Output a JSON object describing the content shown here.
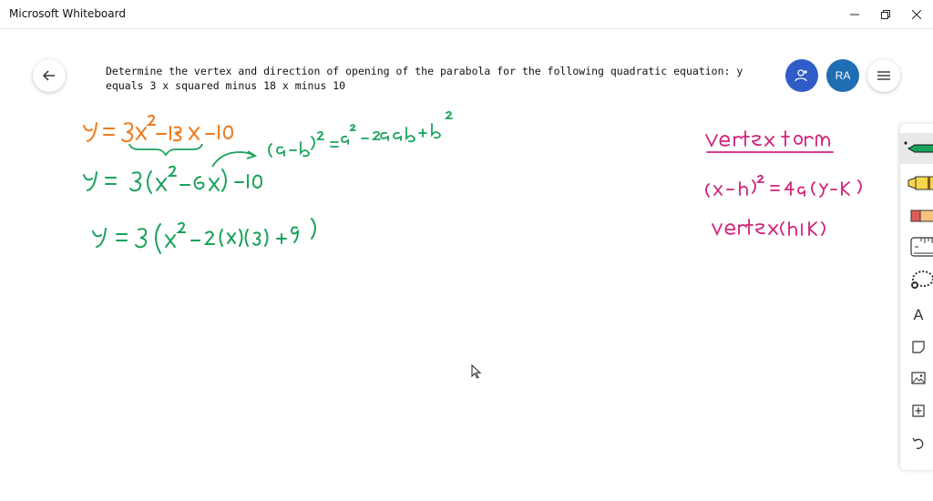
{
  "app": {
    "title": "Microsoft Whiteboard"
  },
  "window": {
    "minimize": "—",
    "restore": "⧉",
    "close": "✕"
  },
  "board": {
    "title": "Determine the vertex and direction of opening of the parabola for the following quadratic equation: y equals 3 x squared minus 18 x minus 10",
    "user_initials": "RA"
  },
  "icons": {
    "back": "back-arrow-icon",
    "share": "add-person-icon",
    "menu": "hamburger-menu-icon",
    "tools": [
      "pen-icon",
      "highlighter-icon",
      "eraser-icon",
      "ruler-icon",
      "lasso-icon",
      "text-icon",
      "sticky-note-icon",
      "image-icon",
      "add-icon",
      "undo-icon"
    ]
  },
  "toolbar": {
    "text_tool_label": "A"
  },
  "colors": {
    "orange_ink": "#ee7a1e",
    "green_ink": "#1aa25a",
    "pink_ink": "#d0237a",
    "avatar_bg": "#1f6db3",
    "share_bg": "#2f5cc7"
  }
}
